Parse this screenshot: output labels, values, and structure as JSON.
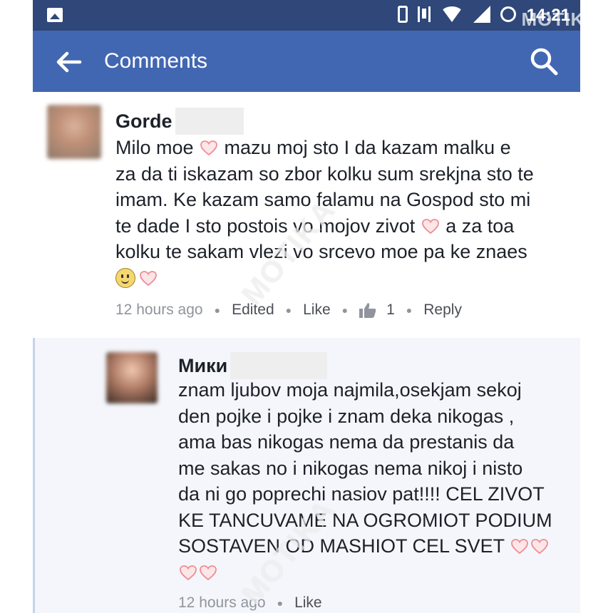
{
  "status_bar": {
    "time": "14:21"
  },
  "header": {
    "title": "Comments"
  },
  "watermark": "MOTIKA",
  "comments": [
    {
      "author": "Gorde",
      "lines": [
        [
          "Milo moe ",
          "heart",
          " mazu moj sto I da kazam malku e"
        ],
        [
          "za da ti iskazam so zbor kolku sum srekjna sto te"
        ],
        [
          "imam. Ke kazam samo falamu na Gospod sto mi"
        ],
        [
          "te dade I sto postois vo mojov zivot ",
          "heart",
          " a za toa"
        ],
        [
          "kolku te sakam vlezi vo srcevo moe pa ke znaes"
        ],
        [
          "smile",
          "heart"
        ]
      ],
      "time": "12 hours ago",
      "edited": "Edited",
      "like": "Like",
      "like_count": "1",
      "reply": "Reply"
    },
    {
      "author": "Мики",
      "lines": [
        [
          "znam ljubov moja najmila,osekjam sekoj"
        ],
        [
          "den pojke i pojke i znam deka nikogas ,"
        ],
        [
          "ama bas nikogas nema da prestanis da"
        ],
        [
          "me sakas no i nikogas nema nikoj i nisto"
        ],
        [
          "da ni go poprechi nasiov pat!!!! CEL ZIVOT"
        ],
        [
          "KE TANCUVAME NA OGROMIOT PODIUM"
        ],
        [
          "SOSTAVEN OD MASHIOT CEL SVET ",
          "heart",
          "heart"
        ],
        [
          "heart",
          "heart"
        ]
      ],
      "time": "12 hours ago",
      "like": "Like"
    }
  ],
  "colors": {
    "status_bar": "#2f4779",
    "app_bar": "#4267b2",
    "heart": "#ef8d95"
  }
}
